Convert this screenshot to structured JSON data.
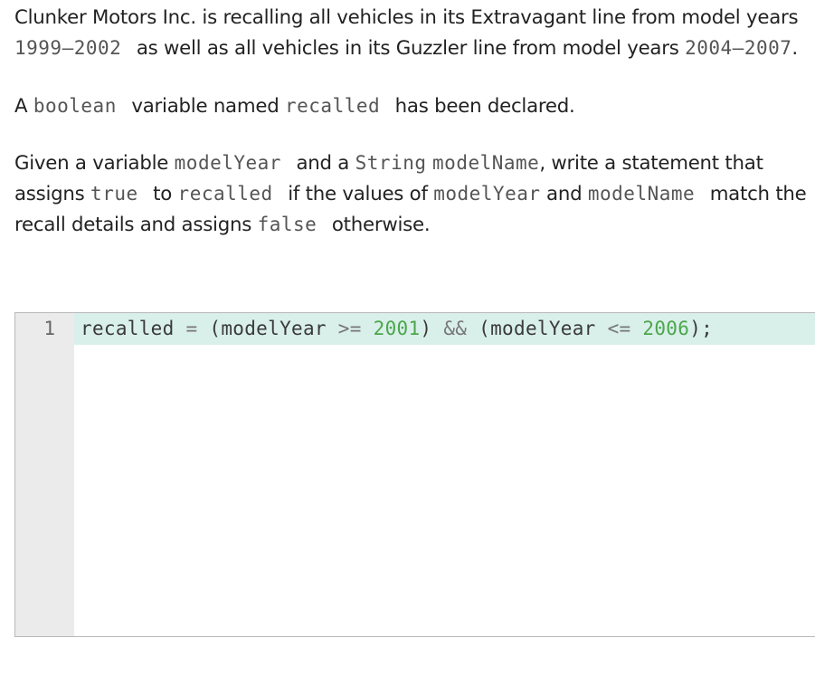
{
  "prompt": {
    "p1": {
      "a": "Clunker Motors Inc. is recalling all vehicles in its Extravagant line from model years ",
      "b": "1999—2002",
      "c": " as well as all vehicles in its Guzzler line from model years ",
      "d": "2004—2007",
      "e": "."
    },
    "p2": {
      "a": "A ",
      "b": "boolean",
      "c": " variable named ",
      "d": "recalled",
      "e": " has been declared."
    },
    "p3": {
      "a": "Given a variable ",
      "b": "modelYear",
      "c": " and a ",
      "d": "String",
      "e": " ",
      "f": "modelName",
      "g": ", write a statement that assigns ",
      "h": "true",
      "i": " to ",
      "j": "recalled",
      "k": " if the values of ",
      "l": "modelYear",
      "m": " and ",
      "n": "modelName",
      "o": " match the recall details and assigns ",
      "p": "false",
      "q": " otherwise."
    }
  },
  "editor": {
    "line_number": "1",
    "tokens": {
      "t1": "recalled",
      "t2": "=",
      "t3": "(modelYear",
      "t4": ">=",
      "t5": "2001",
      "t6": ")",
      "t7": "&&",
      "t8": "(modelYear",
      "t9": "<=",
      "t10": "2006",
      "t11": ");"
    }
  }
}
